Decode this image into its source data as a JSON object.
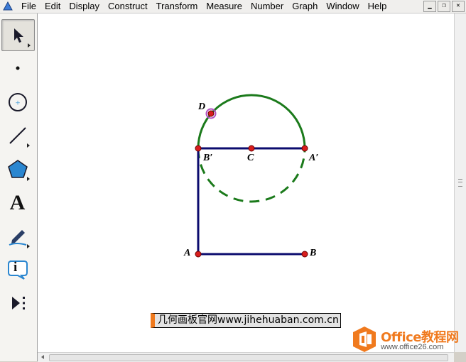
{
  "menu": {
    "items": [
      "File",
      "Edit",
      "Display",
      "Construct",
      "Transform",
      "Measure",
      "Number",
      "Graph",
      "Window",
      "Help"
    ]
  },
  "window_buttons": {
    "minimize": "▁",
    "restore": "❐",
    "close": "✕"
  },
  "toolbar": {
    "tools": [
      "arrow-select",
      "point",
      "compass",
      "straightedge",
      "polygon",
      "text",
      "marker",
      "information",
      "custom-tools"
    ],
    "text_tool_glyph": "A",
    "info_tool_glyph": "i"
  },
  "canvas": {
    "labels": {
      "D": "D",
      "B_prime": "B′",
      "C": "C",
      "A_prime": "A′",
      "A": "A",
      "B": "B"
    },
    "colors": {
      "segment": "#0b0b6e",
      "arc": "#1b7a1b",
      "point": "#d81d1d",
      "selected_ring": "#b04fc0"
    }
  },
  "caption": {
    "text": "几何画板官网www.jihehuaban.com.cn"
  },
  "logo": {
    "brand": "Office教程网",
    "site": "www.office26.com",
    "accent": "#f07a1e"
  }
}
